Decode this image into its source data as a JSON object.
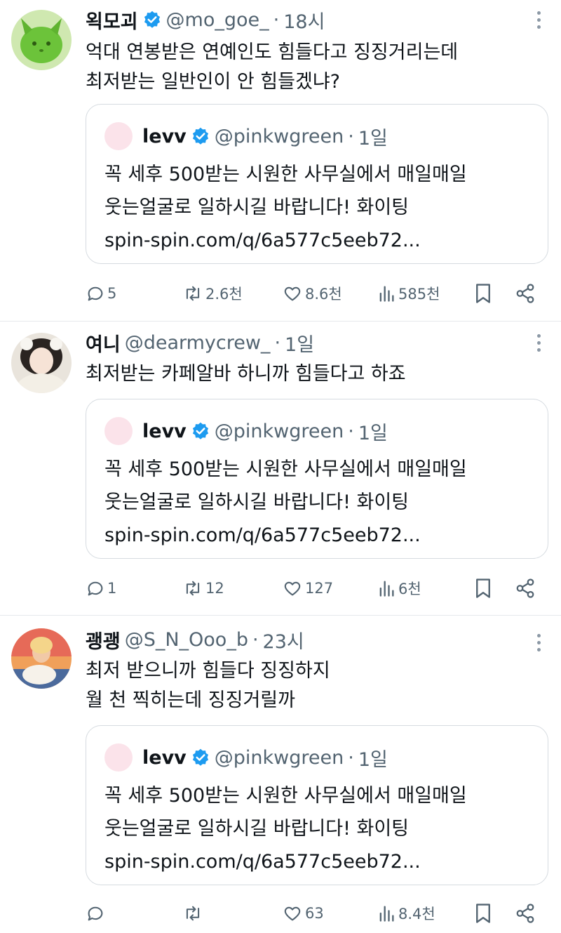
{
  "colors": {
    "accent": "#1d9bf0",
    "muted": "#536471",
    "text": "#0f1419",
    "border": "#d6dbe0"
  },
  "tweets": [
    {
      "name": "왹모괴",
      "handle": "@mo_goe_",
      "time": "18시",
      "verified": true,
      "avatar_icon": "green-cat-avatar",
      "text_lines": [
        "억대 연봉받은 연예인도 힘들다고 징징거리는데",
        "최저받는 일반인이 안 힘들겠냐?"
      ],
      "quote": {
        "name": "levv",
        "handle": "@pinkwgreen",
        "time": "1일",
        "verified": true,
        "text_lines": [
          "꼭 세후 500받는 시원한 사무실에서 매일매일",
          "웃는얼굴로 일하시길 바랍니다! 화이팅",
          "spin-spin.com/q/6a577c5eeb72..."
        ]
      },
      "stats": {
        "replies": "5",
        "retweets": "2.6천",
        "likes": "8.6천",
        "views": "585천"
      }
    },
    {
      "name": "여니",
      "handle": "@dearmycrew_",
      "time": "1일",
      "verified": false,
      "avatar_icon": "girl-photo-avatar",
      "text_lines": [
        "최저받는 카페알바 하니까 힘들다고 하죠"
      ],
      "quote": {
        "name": "levv",
        "handle": "@pinkwgreen",
        "time": "1일",
        "verified": true,
        "text_lines": [
          "꼭 세후 500받는 시원한 사무실에서 매일매일",
          "웃는얼굴로 일하시길 바랍니다! 화이팅",
          "spin-spin.com/q/6a577c5eeb72..."
        ]
      },
      "stats": {
        "replies": "1",
        "retweets": "12",
        "likes": "127",
        "views": "6천"
      }
    },
    {
      "name": "괭괭",
      "handle": "@S_N_Ooo_b",
      "time": "23시",
      "verified": false,
      "avatar_icon": "sunset-photo-avatar",
      "text_lines": [
        "최저 받으니까 힘들다 징징하지",
        "월 천 찍히는데 징징거릴까"
      ],
      "quote": {
        "name": "levv",
        "handle": "@pinkwgreen",
        "time": "1일",
        "verified": true,
        "text_lines": [
          "꼭 세후 500받는 시원한 사무실에서 매일매일",
          "웃는얼굴로 일하시길 바랍니다! 화이팅",
          "spin-spin.com/q/6a577c5eeb72..."
        ]
      },
      "stats": {
        "replies": "",
        "retweets": "",
        "likes": "63",
        "views": "8.4천"
      }
    }
  ]
}
